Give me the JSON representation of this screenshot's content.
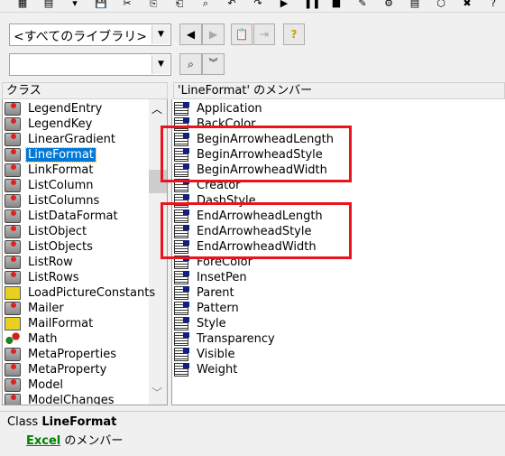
{
  "toolbar": {
    "icons": [
      "excel-icon",
      "insert-userform-icon",
      "dropdown-icon",
      "save-icon",
      "cut-icon",
      "copy-icon",
      "paste-icon",
      "find-icon",
      "undo-icon",
      "redo-icon",
      "run-icon",
      "break-icon",
      "reset-icon",
      "design-mode-icon",
      "project-explorer-icon",
      "properties-icon",
      "object-browser-icon",
      "toolbox-icon",
      "help-icon"
    ]
  },
  "library_combo": {
    "value": "<すべてのライブラリ>"
  },
  "search_combo": {
    "value": ""
  },
  "classes": {
    "header": "クラス",
    "items": [
      {
        "label": "LegendEntry",
        "icon": "class"
      },
      {
        "label": "LegendKey",
        "icon": "class"
      },
      {
        "label": "LinearGradient",
        "icon": "class"
      },
      {
        "label": "LineFormat",
        "icon": "class",
        "selected": true
      },
      {
        "label": "LinkFormat",
        "icon": "class"
      },
      {
        "label": "ListColumn",
        "icon": "class"
      },
      {
        "label": "ListColumns",
        "icon": "class"
      },
      {
        "label": "ListDataFormat",
        "icon": "class"
      },
      {
        "label": "ListObject",
        "icon": "class"
      },
      {
        "label": "ListObjects",
        "icon": "class"
      },
      {
        "label": "ListRow",
        "icon": "class"
      },
      {
        "label": "ListRows",
        "icon": "class"
      },
      {
        "label": "LoadPictureConstants",
        "icon": "enum"
      },
      {
        "label": "Mailer",
        "icon": "class"
      },
      {
        "label": "MailFormat",
        "icon": "enum"
      },
      {
        "label": "Math",
        "icon": "module"
      },
      {
        "label": "MetaProperties",
        "icon": "class"
      },
      {
        "label": "MetaProperty",
        "icon": "class"
      },
      {
        "label": "Model",
        "icon": "class"
      },
      {
        "label": "ModelChanges",
        "icon": "class"
      }
    ]
  },
  "members": {
    "header": "'LineFormat' のメンバー",
    "items": [
      "Application",
      "BackColor",
      "BeginArrowheadLength",
      "BeginArrowheadStyle",
      "BeginArrowheadWidth",
      "Creator",
      "DashStyle",
      "EndArrowheadLength",
      "EndArrowheadStyle",
      "EndArrowheadWidth",
      "ForeColor",
      "InsetPen",
      "Parent",
      "Pattern",
      "Style",
      "Transparency",
      "Visible",
      "Weight"
    ]
  },
  "details": {
    "prefix": "Class",
    "name": "LineFormat",
    "library_link": "Excel",
    "suffix": "のメンバー"
  },
  "colors": {
    "selection": "#0078d7",
    "highlight_box": "#e8141e",
    "link": "#008000"
  }
}
